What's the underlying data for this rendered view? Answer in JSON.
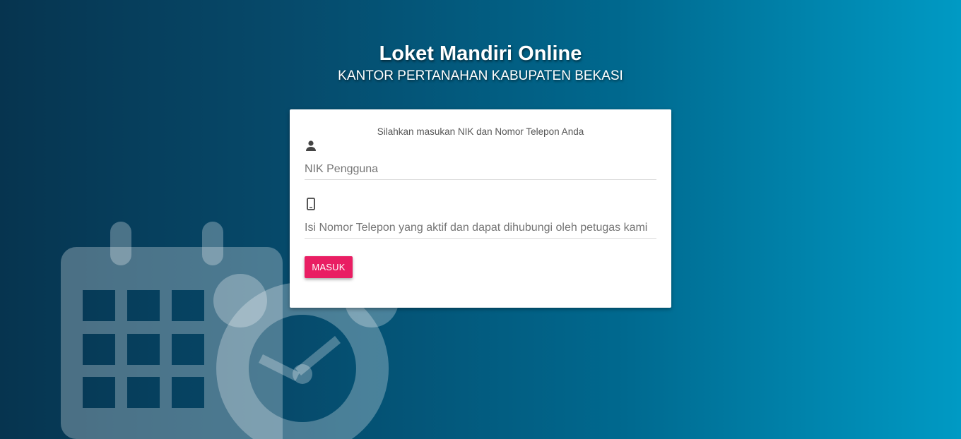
{
  "header": {
    "title": "Loket Mandiri Online",
    "subtitle": "KANTOR PERTANAHAN KABUPATEN BEKASI"
  },
  "login_card": {
    "instruction": "Silahkan masukan NIK dan Nomor Telepon Anda",
    "nik_field": {
      "icon": "person-icon",
      "value": "",
      "placeholder": "NIK Pengguna"
    },
    "phone_field": {
      "icon": "mobile-phone-icon",
      "value": "",
      "placeholder": "Isi Nomor Telepon yang aktif dan dapat dihubungi oleh petugas kami"
    },
    "submit_label": "MASUK"
  },
  "background": {
    "illustration": "calendar-clock-icon"
  },
  "colors": {
    "accent": "#e91e63",
    "background_start": "#06344f",
    "background_end": "#009ac4"
  }
}
